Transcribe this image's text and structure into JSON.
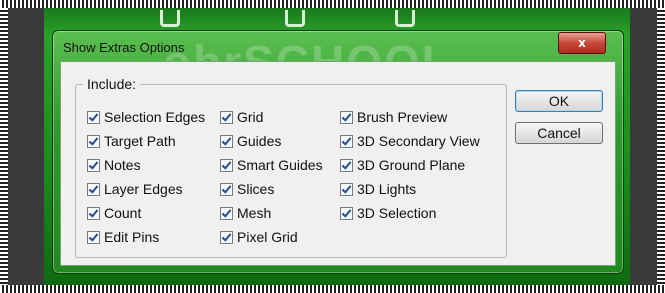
{
  "dialog": {
    "title": "Show Extras Options",
    "close_label": "x",
    "watermark": "ohrSCHOOL"
  },
  "include": {
    "legend": "Include:",
    "columns": [
      [
        {
          "label": "Selection Edges",
          "checked": true
        },
        {
          "label": "Target Path",
          "checked": true
        },
        {
          "label": "Notes",
          "checked": true
        },
        {
          "label": "Layer Edges",
          "checked": true
        },
        {
          "label": "Count",
          "checked": true
        },
        {
          "label": "Edit Pins",
          "checked": true
        }
      ],
      [
        {
          "label": "Grid",
          "checked": true
        },
        {
          "label": "Guides",
          "checked": true
        },
        {
          "label": "Smart Guides",
          "checked": true
        },
        {
          "label": "Slices",
          "checked": true
        },
        {
          "label": "Mesh",
          "checked": true
        },
        {
          "label": "Pixel Grid",
          "checked": true
        }
      ],
      [
        {
          "label": "Brush Preview",
          "checked": true
        },
        {
          "label": "3D Secondary View",
          "checked": true
        },
        {
          "label": "3D Ground Plane",
          "checked": true
        },
        {
          "label": "3D Lights",
          "checked": true
        },
        {
          "label": "3D Selection",
          "checked": true
        }
      ]
    ]
  },
  "buttons": {
    "ok": "OK",
    "cancel": "Cancel"
  }
}
